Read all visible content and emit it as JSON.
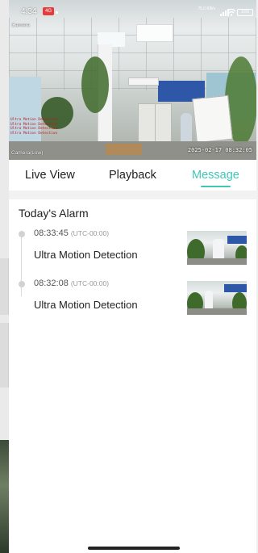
{
  "status_bar": {
    "time": "4:34",
    "badge": "4G",
    "network_speed": "75.0 KB/s",
    "battery": "100"
  },
  "video": {
    "camera_label_top": "Camera",
    "camera_label_bottom": "Camera(Low)",
    "timestamp": "2025-02-17 08:32:05",
    "osd_lines": [
      "Ultra Motion Detection",
      "Ultra Motion Detection",
      "Ultra Motion Detection",
      "Ultra Motion Detection"
    ]
  },
  "tabs": [
    {
      "label": "Live View",
      "active": false
    },
    {
      "label": "Playback",
      "active": false
    },
    {
      "label": "Message",
      "active": true
    }
  ],
  "accent_color": "#3fc7b6",
  "alarms": {
    "title": "Today's Alarm",
    "items": [
      {
        "time": "08:33:45",
        "timezone": "(UTC-00:00)",
        "type": "Ultra Motion Detection"
      },
      {
        "time": "08:32:08",
        "timezone": "(UTC-00:00)",
        "type": "Ultra Motion Detection"
      }
    ]
  }
}
